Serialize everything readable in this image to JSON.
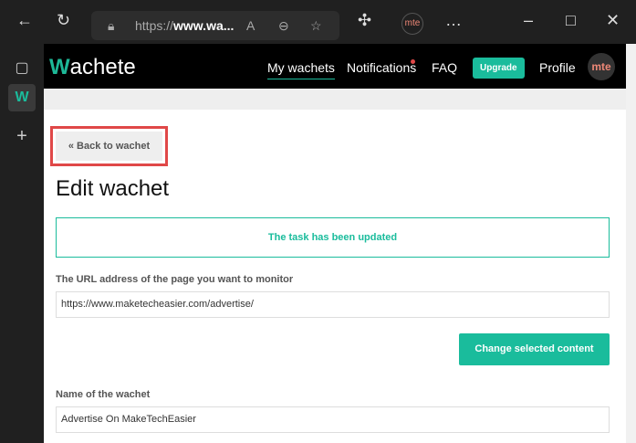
{
  "browser": {
    "url": "https://www.wa...",
    "url_prefix": "https://",
    "url_host": "www.wa...",
    "profile": "mte"
  },
  "nav": {
    "logo": "Wachete",
    "items": [
      "My wachets",
      "Notifications",
      "FAQ"
    ],
    "upgrade": "Upgrade",
    "profile": "Profile",
    "avatar": "mte"
  },
  "main": {
    "back": "« Back to wachet",
    "title": "Edit wachet",
    "alert": "The task has been updated",
    "url_label": "The URL address of the page you want to monitor",
    "url_value": "https://www.maketecheasier.com/advertise/",
    "change_button": "Change selected content",
    "name_label": "Name of the wachet",
    "name_value": "Advertise On MakeTechEasier"
  },
  "colors": {
    "accent": "#1abc9c",
    "highlight": "#e04848"
  }
}
